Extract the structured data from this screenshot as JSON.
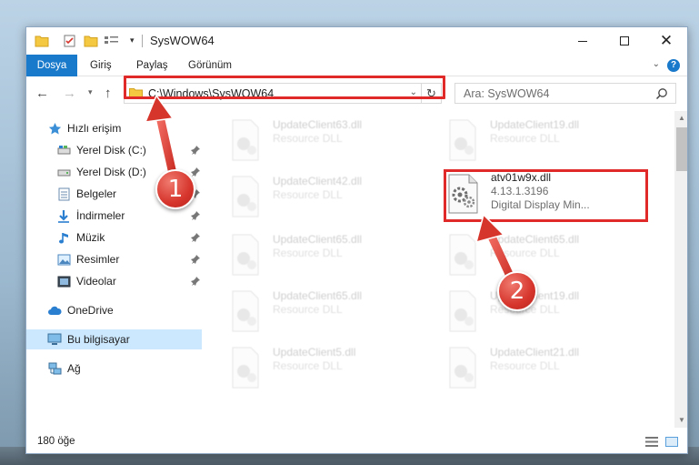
{
  "window": {
    "title": "SysWOW64"
  },
  "ribbon": {
    "tabs": [
      "Dosya",
      "Giriş",
      "Paylaş",
      "Görünüm"
    ],
    "help_label": "?"
  },
  "nav": {
    "address": "C:\\Windows\\SysWOW64",
    "search_placeholder": "Ara: SysWOW64"
  },
  "sidebar": {
    "items": [
      {
        "label": "Hızlı erişim",
        "icon": "star-icon",
        "pinned": false
      },
      {
        "label": "Yerel Disk (C:)",
        "icon": "drive-icon",
        "pinned": true
      },
      {
        "label": "Yerel Disk (D:)",
        "icon": "drive-icon",
        "pinned": true
      },
      {
        "label": "Belgeler",
        "icon": "documents-icon",
        "pinned": true
      },
      {
        "label": "İndirmeler",
        "icon": "download-icon",
        "pinned": true
      },
      {
        "label": "Müzik",
        "icon": "music-icon",
        "pinned": true
      },
      {
        "label": "Resimler",
        "icon": "pictures-icon",
        "pinned": true
      },
      {
        "label": "Videolar",
        "icon": "videos-icon",
        "pinned": true
      },
      {
        "label": "OneDrive",
        "icon": "cloud-icon",
        "pinned": false
      },
      {
        "label": "Bu bilgisayar",
        "icon": "computer-icon",
        "pinned": false
      },
      {
        "label": "Ağ",
        "icon": "network-icon",
        "pinned": false
      }
    ]
  },
  "files": [
    {
      "name": "UpdateClient63.dll",
      "desc": "Resource DLL"
    },
    {
      "name": "UpdateClient19.dll",
      "desc": "Resource DLL"
    },
    {
      "name": "UpdateClient42.dll",
      "desc": "Resource DLL"
    },
    {
      "name": "atv01w9x.dll",
      "version": "4.13.1.3196",
      "desc": "Digital Display Min..."
    },
    {
      "name": "UpdateClient65.dll",
      "desc": "Resource DLL"
    },
    {
      "name": "UpdateClient65.dll",
      "desc": "Resource DLL"
    },
    {
      "name": "UpdateClient65.dll",
      "desc": "Resource DLL"
    },
    {
      "name": "UpdateClient19.dll",
      "desc": "Resource DLL"
    },
    {
      "name": "UpdateClient5.dll",
      "desc": "Resource DLL"
    },
    {
      "name": "UpdateClient21.dll",
      "desc": "Resource DLL"
    }
  ],
  "status": {
    "count": "180 öğe"
  },
  "callouts": [
    "1",
    "2"
  ],
  "colors": {
    "accent": "#1979ca",
    "highlight": "#e02a2a",
    "selection": "#cce8ff"
  }
}
